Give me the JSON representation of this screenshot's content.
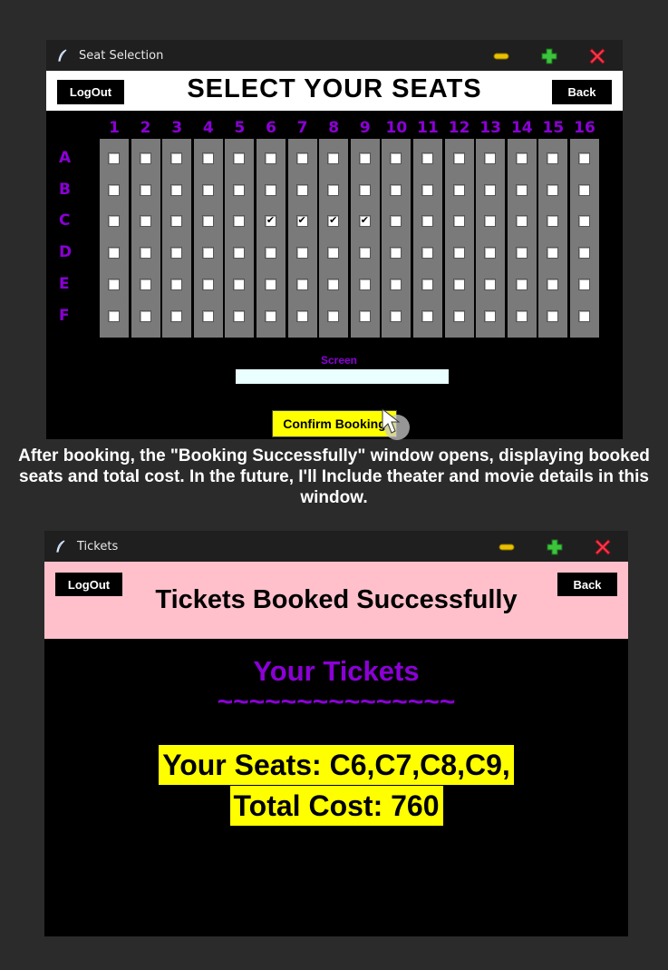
{
  "seat_window": {
    "title": "Seat Selection",
    "logout_label": "LogOut",
    "back_label": "Back",
    "heading": "SELECT YOUR SEATS",
    "columns": [
      "1",
      "2",
      "3",
      "4",
      "5",
      "6",
      "7",
      "8",
      "9",
      "10",
      "11",
      "12",
      "13",
      "14",
      "15",
      "16"
    ],
    "rows": [
      "A",
      "B",
      "C",
      "D",
      "E",
      "F"
    ],
    "selected_seats": [
      "C6",
      "C7",
      "C8",
      "C9"
    ],
    "screen_label": "Screen",
    "confirm_label": "Confirm Booking"
  },
  "caption": "After booking, the \"Booking Successfully\" window opens, displaying booked seats and total cost. In the future, I'll Include theater and movie details in this window.",
  "tickets_window": {
    "title": "Tickets",
    "logout_label": "LogOut",
    "back_label": "Back",
    "heading": "Tickets Booked Successfully",
    "your_tickets": "Your Tickets",
    "divider": "~~~~~~~~~~~~~~~",
    "seats_line": "Your Seats: C6,C7,C8,C9,",
    "cost_line": "Total Cost: 760"
  },
  "icons": {
    "app": "feather-icon",
    "minimize": "minimize-icon",
    "maximize": "maximize-icon",
    "close": "close-icon"
  },
  "colors": {
    "accent_purple": "#8b00d6",
    "confirm_yellow": "#ffff00",
    "header_pink": "#ffc0cb",
    "seat_strip": "#7a7a7a"
  }
}
